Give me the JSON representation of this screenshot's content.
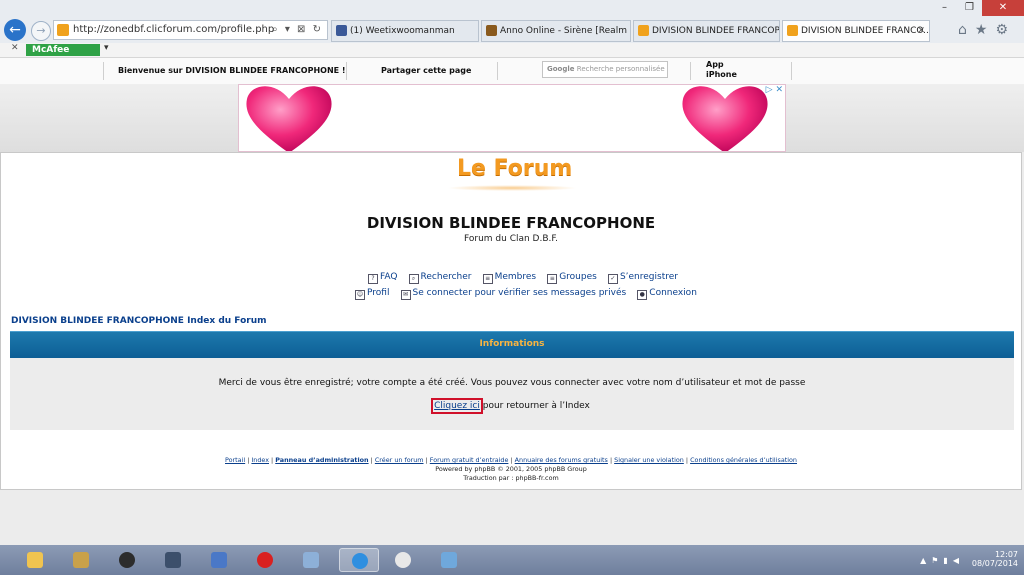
{
  "browser": {
    "url": "http://zonedbf.clicforum.com/profile.php",
    "url_tools": "⌕ ▾ ⊠ ↻",
    "tabs": [
      {
        "label": "(1) Weetixwoomanman",
        "icon_color": "#3b5998"
      },
      {
        "label": "Anno Online - Sirène [Realm 1]",
        "icon_color": "#8a5a1e"
      },
      {
        "label": "DIVISION BLINDEE FRANCOPH...",
        "icon_color": "#f0a21d"
      },
      {
        "label": "DIVISION BLINDEE FRANCO...",
        "icon_color": "#f0a21d"
      }
    ],
    "active_tab_close": "✕",
    "mcafee_label": "McAfee",
    "mcafee_color": "#2fa246"
  },
  "topbar": {
    "welcome": "Bienvenue sur DIVISION BLINDEE FRANCOPHONE !",
    "share": "Partager cette page",
    "search_placeholder": "Recherche personnalisée",
    "google_label": "Google",
    "app_line1": "App",
    "app_line2": "iPhone"
  },
  "forum": {
    "logo": "Le Forum",
    "title": "DIVISION BLINDEE FRANCOPHONE",
    "description": "Forum du Clan D.B.F.",
    "nav_row1": [
      "FAQ",
      "Rechercher",
      "Membres",
      "Groupes",
      "S’enregistrer"
    ],
    "nav_row2": [
      "Profil",
      "Se connecter pour vérifier ses messages privés",
      "Connexion"
    ],
    "breadcrumb": "DIVISION BLINDEE FRANCOPHONE Index du Forum",
    "info_title": "Informations",
    "info_message": "Merci de vous être enregistré; votre compte a été créé. Vous pouvez vous connecter avec votre nom d’utilisateur et mot de passe",
    "click_here": "Cliquez ici",
    "return_text": " pour retourner à l’Index",
    "footer_links": [
      "Portail",
      "Index",
      "Panneau d’administration",
      "Créer un forum",
      "Forum gratuit d’entraide",
      "Annuaire des forums gratuits",
      "Signaler une violation",
      "Conditions générales d’utilisation"
    ],
    "powered": "Powered by phpBB © 2001, 2005 phpBB Group",
    "translated": "Traduction par : phpBB-fr.com",
    "accent_color": "#f39a21",
    "bar_color": "#0d5e95"
  },
  "taskbar": {
    "time": "12:07",
    "date": "08/07/2014"
  }
}
